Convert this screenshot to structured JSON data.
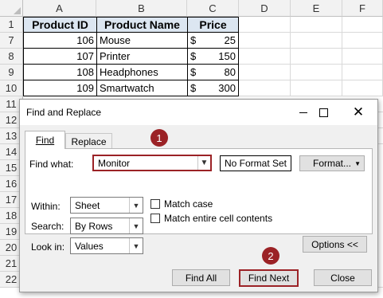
{
  "columns": [
    "A",
    "B",
    "C",
    "D",
    "E",
    "F"
  ],
  "rows": [
    "1",
    "7",
    "8",
    "9",
    "10",
    "11",
    "12",
    "13",
    "14",
    "15",
    "16",
    "17",
    "18",
    "19",
    "20",
    "21",
    "22"
  ],
  "table": {
    "headers": [
      "Product ID",
      "Product Name",
      "Price"
    ],
    "data": [
      {
        "id": "106",
        "name": "Mouse",
        "currency": "$",
        "price": "25"
      },
      {
        "id": "107",
        "name": "Printer",
        "currency": "$",
        "price": "150"
      },
      {
        "id": "108",
        "name": "Headphones",
        "currency": "$",
        "price": "80"
      },
      {
        "id": "109",
        "name": "Smartwatch",
        "currency": "$",
        "price": "300"
      }
    ]
  },
  "dialog": {
    "title": "Find and Replace",
    "tabs": {
      "find": "Find",
      "replace": "Replace"
    },
    "find_what_label": "Find what:",
    "find_what_value": "Monitor",
    "no_format": "No Format Set",
    "format_button": "Format...",
    "within_label": "Within:",
    "within_value": "Sheet",
    "search_label": "Search:",
    "search_value": "By Rows",
    "lookin_label": "Look in:",
    "lookin_value": "Values",
    "match_case": "Match case",
    "match_entire": "Match entire cell contents",
    "options_button": "Options <<",
    "find_all": "Find All",
    "find_next": "Find Next",
    "close": "Close"
  },
  "markers": {
    "one": "1",
    "two": "2"
  },
  "colors": {
    "accent": "#9b2226",
    "header_fill": "#dce6f1"
  }
}
